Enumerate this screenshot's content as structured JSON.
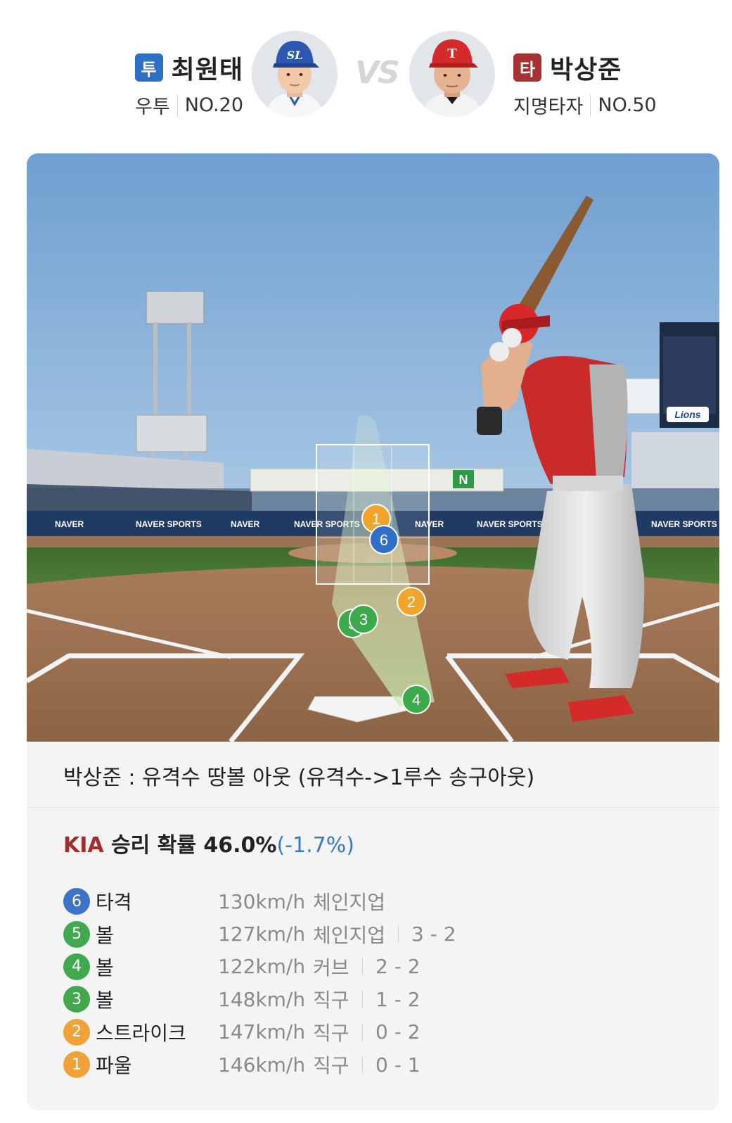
{
  "pitcher": {
    "role": "투",
    "name": "최원태",
    "hand": "우투",
    "number": "NO.20"
  },
  "batter": {
    "role": "타",
    "name": "박상준",
    "position": "지명타자",
    "number": "NO.50"
  },
  "vs": "VS",
  "field": {
    "ad_boards": [
      "NAVER",
      "NAVER SPORTS",
      "NAVER",
      "NAVER SPORTS",
      "NAVER",
      "NAVER SPORTS",
      "NAVER SPORTS"
    ],
    "scoreboard_logo": "Lions",
    "markers": [
      {
        "num": "1",
        "color": "#f0a52d"
      },
      {
        "num": "6",
        "color": "#2f6fc8"
      },
      {
        "num": "2",
        "color": "#f0a52d"
      },
      {
        "num": "5",
        "color": "#3aaa4a"
      },
      {
        "num": "3",
        "color": "#3aaa4a"
      },
      {
        "num": "4",
        "color": "#3aaa4a"
      }
    ]
  },
  "result": {
    "text": "박상준 : 유격수 땅볼 아웃 (유격수->1루수 송구아웃)"
  },
  "win_probability": {
    "team": "KIA",
    "label": " 승리 확률 46.0%",
    "delta": "(-1.7%)"
  },
  "pitches": [
    {
      "num": "6",
      "color": "#3d74c9",
      "result": "타격",
      "speed": "130km/h",
      "type": "체인지업",
      "count": ""
    },
    {
      "num": "5",
      "color": "#41a84d",
      "result": "볼",
      "speed": "127km/h",
      "type": "체인지업",
      "count": "3 - 2"
    },
    {
      "num": "4",
      "color": "#41a84d",
      "result": "볼",
      "speed": "122km/h",
      "type": "커브",
      "count": "2 - 2"
    },
    {
      "num": "3",
      "color": "#41a84d",
      "result": "볼",
      "speed": "148km/h",
      "type": "직구",
      "count": "1 - 2"
    },
    {
      "num": "2",
      "color": "#f0a23a",
      "result": "스트라이크",
      "speed": "147km/h",
      "type": "직구",
      "count": "0 - 2"
    },
    {
      "num": "1",
      "color": "#f0a23a",
      "result": "파울",
      "speed": "146km/h",
      "type": "직구",
      "count": "0 - 1"
    }
  ],
  "colors": {
    "pitcher_badge": "#2f6fc8",
    "batter_badge": "#a83232",
    "team_kia": "#a12c2c",
    "delta_blue": "#3a78c9"
  }
}
